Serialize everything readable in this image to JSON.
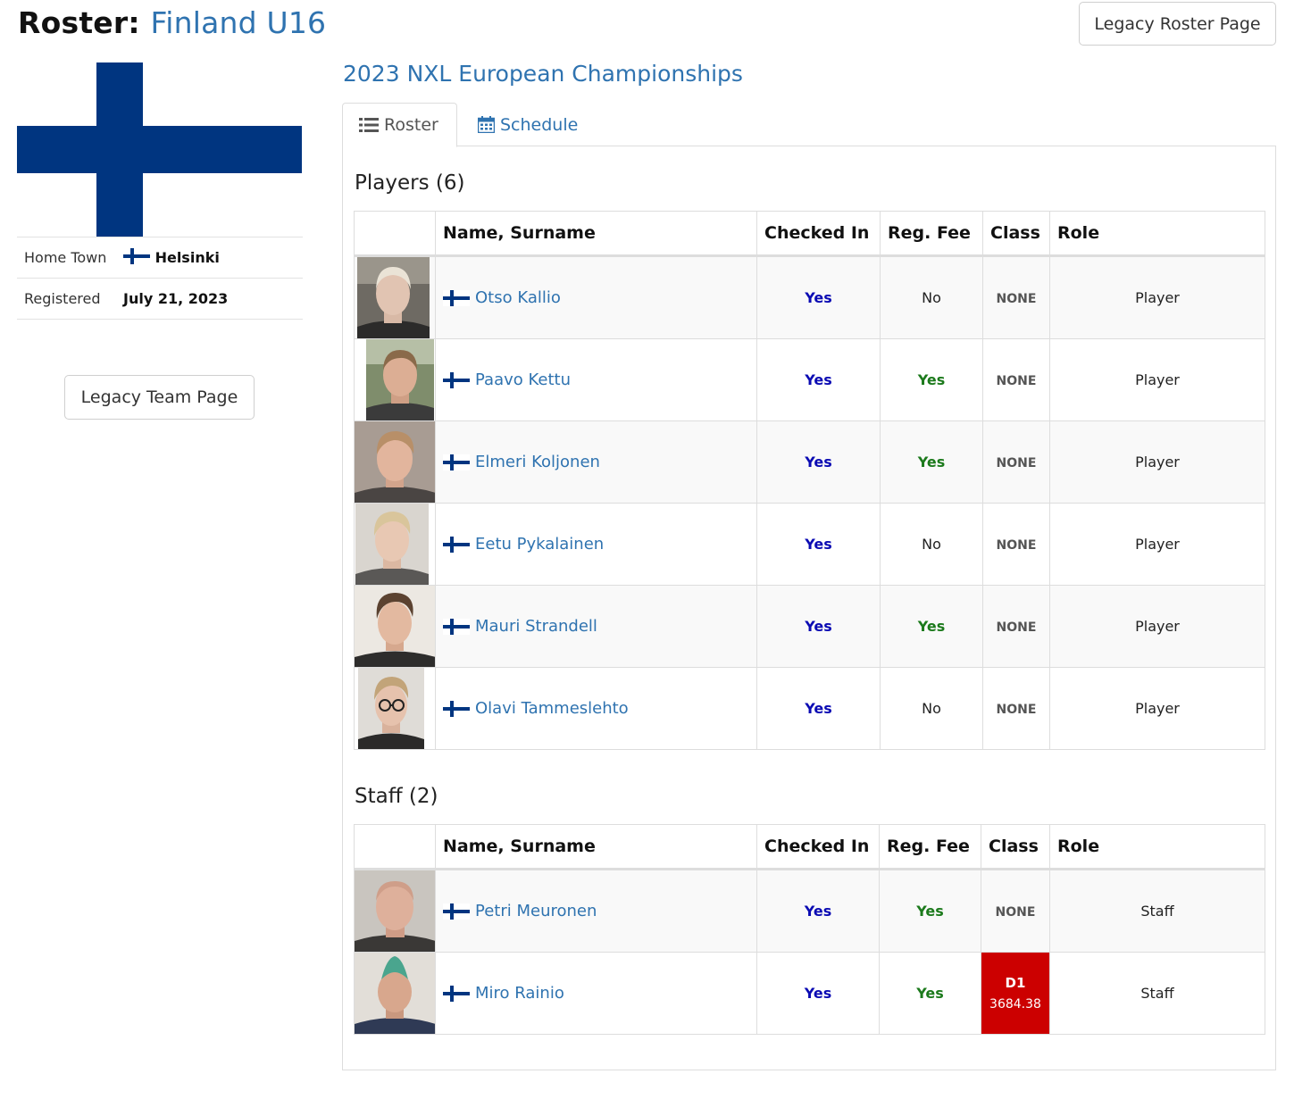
{
  "header": {
    "title_prefix": "Roster:",
    "team_name": "Finland U16",
    "legacy_roster_button": "Legacy Roster Page"
  },
  "team_info": {
    "hometown_label": "Home Town",
    "hometown_value": "Helsinki",
    "registered_label": "Registered",
    "registered_value": "July 21, 2023",
    "legacy_team_button": "Legacy Team Page"
  },
  "event": {
    "title": "2023 NXL European Championships"
  },
  "tabs": [
    {
      "label": "Roster",
      "icon": "list-icon",
      "active": true
    },
    {
      "label": "Schedule",
      "icon": "calendar-icon",
      "active": false
    }
  ],
  "players": {
    "title": "Players (6)",
    "columns": [
      "",
      "Name, Surname",
      "Checked In",
      "Reg. Fee",
      "Class",
      "Role"
    ],
    "rows": [
      {
        "name": "Otso Kallio",
        "checked_in": "Yes",
        "reg_fee": "No",
        "class": "NONE",
        "role": "Player"
      },
      {
        "name": "Paavo Kettu",
        "checked_in": "Yes",
        "reg_fee": "Yes",
        "class": "NONE",
        "role": "Player"
      },
      {
        "name": "Elmeri Koljonen",
        "checked_in": "Yes",
        "reg_fee": "Yes",
        "class": "NONE",
        "role": "Player"
      },
      {
        "name": "Eetu Pykalainen",
        "checked_in": "Yes",
        "reg_fee": "No",
        "class": "NONE",
        "role": "Player"
      },
      {
        "name": "Mauri Strandell",
        "checked_in": "Yes",
        "reg_fee": "Yes",
        "class": "NONE",
        "role": "Player"
      },
      {
        "name": "Olavi Tammeslehto",
        "checked_in": "Yes",
        "reg_fee": "No",
        "class": "NONE",
        "role": "Player"
      }
    ]
  },
  "staff": {
    "title": "Staff (2)",
    "columns": [
      "",
      "Name, Surname",
      "Checked In",
      "Reg. Fee",
      "Class",
      "Role"
    ],
    "rows": [
      {
        "name": "Petri Meuronen",
        "checked_in": "Yes",
        "reg_fee": "Yes",
        "class": "NONE",
        "role": "Staff"
      },
      {
        "name": "Miro Rainio",
        "checked_in": "Yes",
        "reg_fee": "Yes",
        "class_grade": "D1",
        "class_score": "3684.38",
        "role": "Staff"
      }
    ]
  },
  "colors": {
    "link": "#2f73b0",
    "flag_blue": "#003580",
    "yes_checked_in": "#0b0bb3",
    "yes_reg_fee": "#1c7a1c",
    "class_badge_red": "#cc0000"
  }
}
